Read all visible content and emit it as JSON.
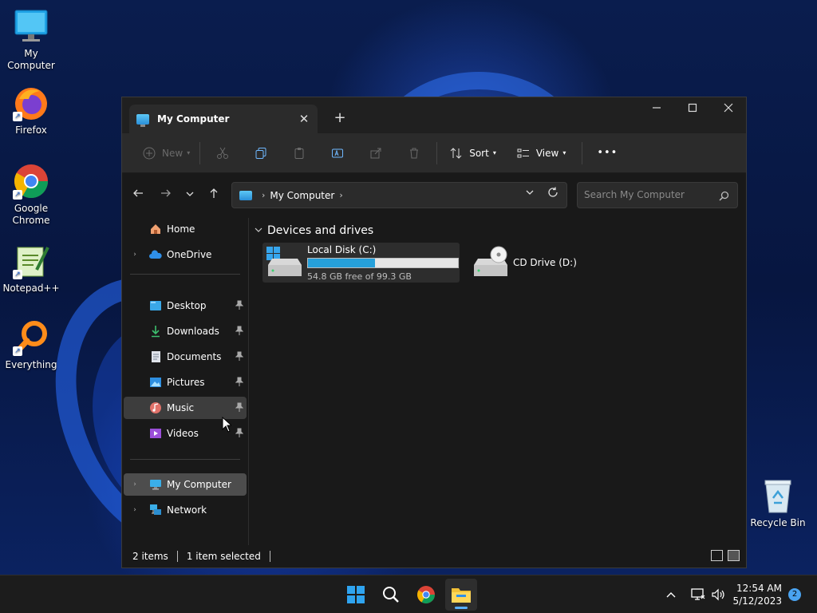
{
  "desktop": {
    "icons": [
      {
        "label": "My Computer"
      },
      {
        "label": "Firefox"
      },
      {
        "label": "Google Chrome"
      },
      {
        "label": "Notepad++"
      },
      {
        "label": "Everything"
      },
      {
        "label": "Recycle Bin"
      }
    ]
  },
  "window": {
    "tab_title": "My Computer",
    "new_tab_symbol": "+"
  },
  "toolbar": {
    "new_label": "New",
    "sort_label": "Sort",
    "view_label": "View",
    "more_label": "•••"
  },
  "address": {
    "location": "My Computer",
    "search_placeholder": "Search My Computer"
  },
  "sidebar": {
    "home": "Home",
    "onedrive": "OneDrive",
    "quick": [
      {
        "label": "Desktop"
      },
      {
        "label": "Downloads"
      },
      {
        "label": "Documents"
      },
      {
        "label": "Pictures"
      },
      {
        "label": "Music"
      },
      {
        "label": "Videos"
      }
    ],
    "my_computer": "My Computer",
    "network": "Network"
  },
  "content": {
    "group_header": "Devices and drives",
    "drives": [
      {
        "name": "Local Disk (C:)",
        "space": "54.8 GB free of 99.3 GB",
        "used_fraction": 0.448
      },
      {
        "name": "CD Drive (D:)"
      }
    ]
  },
  "status": {
    "items": "2 items",
    "selected": "1 item selected"
  },
  "taskbar": {
    "time": "12:54 AM",
    "date": "5/12/2023",
    "notifications": "2"
  },
  "colors": {
    "accent": "#26a0da",
    "window_bg": "#191919",
    "selection": "#4d4d4d"
  }
}
